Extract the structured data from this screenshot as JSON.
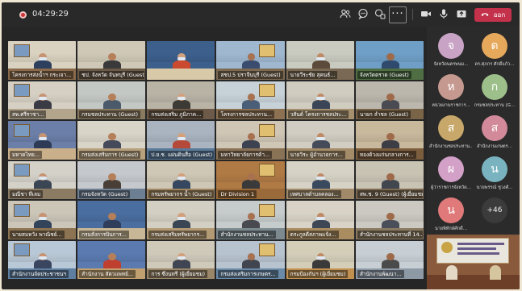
{
  "meeting": {
    "timer": "04:29:29",
    "leave_label": "ออก",
    "more_label": "···"
  },
  "icons": {
    "participants": "people-icon",
    "chat": "chat-icon",
    "reactions": "reactions-icon",
    "more": "more-icon",
    "camera": "camera-icon",
    "mic": "mic-icon",
    "share": "share-icon",
    "hangup": "phone-icon"
  },
  "colors": {
    "leave": "#c4314b",
    "recording": "#d13438",
    "toolbar": "#292929"
  },
  "tiles": [
    {
      "name": "โครงการส่งน้ำฯ กระเจา..."
    },
    {
      "name": "ชป. จังหวัด จันทบุรี (Guest)"
    },
    {
      "name": ""
    },
    {
      "name": "สชป.5 ปราจีนบุรี (Guest)"
    },
    {
      "name": "นายวีระชัย สุคนธ์..."
    },
    {
      "name": "จังหวัดตราด (Guest)"
    },
    {
      "name": "สพ.ศรีราชา..."
    },
    {
      "name": "กรมชลประทาน (Guest)"
    },
    {
      "name": "กรมส่งเสริม ภูมิภาค..."
    },
    {
      "name": "โครงการชลประทาน..."
    },
    {
      "name": "วสันต์ โครงการชลประ..."
    },
    {
      "name": "นายก ลำชล (Guest)"
    },
    {
      "name": "มหาดไทย..."
    },
    {
      "name": "กรมส่งเสริมการ (Guest)"
    },
    {
      "name": "ป.ย.ช. แผ่นดินสื่อ (Guest)"
    },
    {
      "name": "มหาวิทยาลัยการค้า..."
    },
    {
      "name": "นายวิระ ผู้อำนวยการ..."
    },
    {
      "name": "ทองด้วงแก่นกลางการ..."
    },
    {
      "name": "มณีชา ทีเลม"
    },
    {
      "name": "กรมจังหวัด (Guest)"
    },
    {
      "name": "กรมทรัพยากร น้ำ (Guest)"
    },
    {
      "name": "Dr Division 1"
    },
    {
      "name": "เทศบาลตำบลคลอง..."
    },
    {
      "name": "สพ.ช. 9 (Guest) (ผู้เยี่ยมชม)"
    },
    {
      "name": "นายสมหวัง พาณิชย์..."
    },
    {
      "name": "กรมสั่งการบินการ..."
    },
    {
      "name": "กรมส่งเสริมทรัพยากร..."
    },
    {
      "name": "สำนักงานชลประทาน..."
    },
    {
      "name": "ตระกูลดีสภาพแจ้ง..."
    },
    {
      "name": "สำนักงานชลประทานที่ 14..."
    },
    {
      "name": "สำนักงานจัดประชาชนฯ"
    },
    {
      "name": "สำนักงาน สัตวแพทย์..."
    },
    {
      "name": "การ ซึ่งนทรี (ผู้เยี่ยมชม)"
    },
    {
      "name": "กรมส่งเสริมการเกษตร..."
    },
    {
      "name": "กรมป้องกันฯ (ผู้เยี่ยมชม)"
    },
    {
      "name": "สำนักงานพัฒนา..."
    }
  ],
  "side_participants": [
    {
      "initial": "จ",
      "label": "จังหวัดนครพนม...",
      "color": "#c9a3c6"
    },
    {
      "initial": "ด",
      "label": "ดร.ศุภกร ศักดิ์แก้ว...",
      "color": "#e6a85b"
    },
    {
      "initial": "ห",
      "label": "หน่วยงานราชการ...",
      "color": "#c5998f"
    },
    {
      "initial": "ก",
      "label": "กรมชลประทาน (G...",
      "color": "#9dc08a"
    },
    {
      "initial": "ส",
      "label": "สำนักงานชลประทาน...",
      "color": "#c8a86a"
    },
    {
      "initial": "ส",
      "label": "สำนักงานเกษตร...",
      "color": "#d28a9a"
    },
    {
      "initial": "ผ",
      "label": "ผู้ว่าราชการจังหวัด...",
      "color": "#d3a0c8"
    },
    {
      "initial": "น",
      "label": "นายพรรณ์ ชูวงศ์...",
      "color": "#7ab3c0"
    },
    {
      "initial": "น",
      "label": "นายพิทักษ์ศักดิ์...",
      "color": "#e07a7a"
    }
  ],
  "overflow_count": "+46"
}
